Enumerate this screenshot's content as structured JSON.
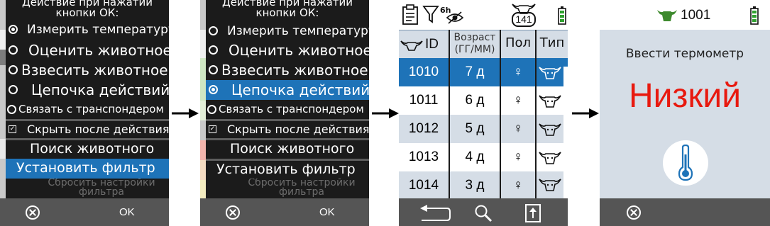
{
  "menu_screen": {
    "title_line1": "Действие при нажатии",
    "title_line2": "кнопки ОК:",
    "items": [
      {
        "label": "Измерить температуру"
      },
      {
        "label": "Оценить животное"
      },
      {
        "label": "Взвесить животное"
      },
      {
        "label": "Цепочка действий"
      },
      {
        "label": "Связать с транспондером"
      }
    ],
    "hide_after_action": "Скрыть после действия",
    "search_animal": "Поиск животного",
    "set_filter": "Установить фильтр",
    "reset_filter_line1": "Сбросить настройки",
    "reset_filter_line2": "фильтра",
    "selected_in_screen1": 0,
    "selected_in_screen2": 3,
    "ok_label": "OK"
  },
  "table_screen": {
    "filter_time": "6h",
    "animal_count": "141",
    "columns": {
      "id": "ID",
      "age_line1": "Возраст",
      "age_line2": "(ГГ/ММ)",
      "sex": "Пол",
      "type": "Тип"
    },
    "rows": [
      {
        "id": "1010",
        "age": "7 д",
        "sex": "♀"
      },
      {
        "id": "1011",
        "age": "6 д",
        "sex": "♀"
      },
      {
        "id": "1012",
        "age": "5 д",
        "sex": "♀"
      },
      {
        "id": "1013",
        "age": "4 д",
        "sex": "♀"
      },
      {
        "id": "1014",
        "age": "3 д",
        "sex": "♀"
      }
    ],
    "selected_row": 0
  },
  "thermo_screen": {
    "animal_id": "1001",
    "prompt": "Ввести термометр",
    "result": "Низкий"
  },
  "colors": {
    "accent_blue": "#1e73b8",
    "result_red": "#e8190f",
    "cow_green": "#3e8a2e",
    "battery_green": "#2fa12f"
  },
  "icons": {
    "cancel": "circle-x-icon",
    "back": "return-arrow-icon",
    "search": "magnifier-icon",
    "export": "upload-box-icon",
    "thermometer": "thermometer-icon",
    "battery": "battery-icon"
  }
}
